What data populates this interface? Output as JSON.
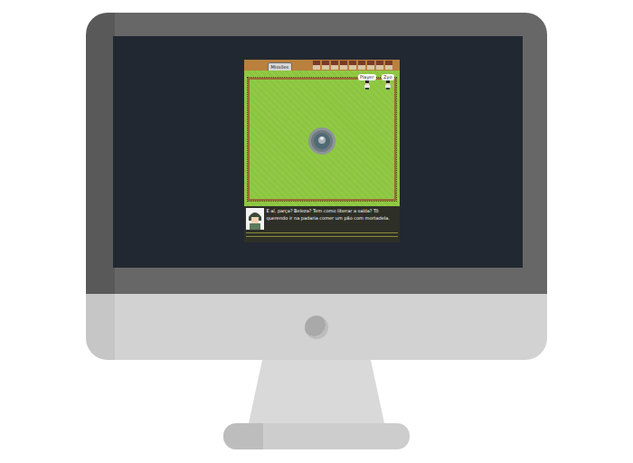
{
  "game": {
    "hud": {
      "missions_button": "Missões"
    },
    "characters": [
      {
        "name": "Player"
      },
      {
        "name": "Zyo"
      }
    ],
    "dialog": {
      "text": "E aí, parça? Beleza? Tem como liberar a saída? Tô querendo ir na padaria comer um pão com mortadela."
    }
  }
}
